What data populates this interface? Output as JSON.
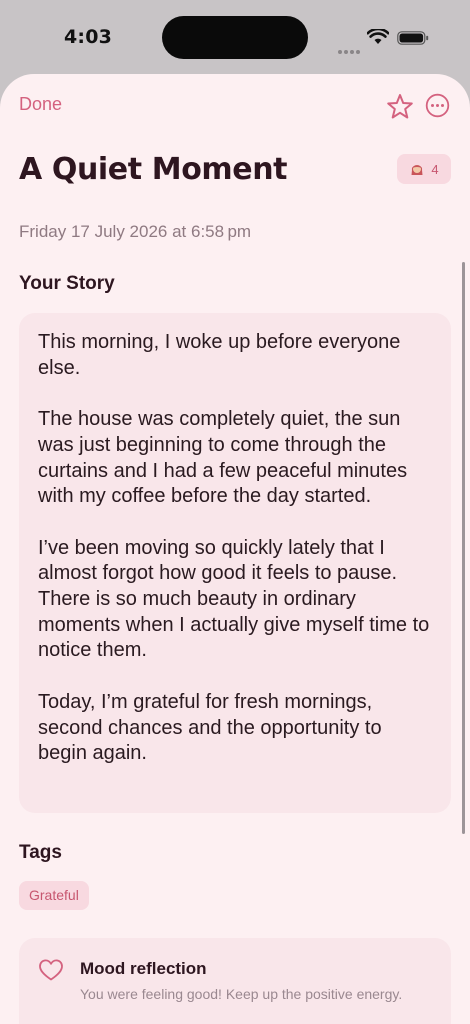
{
  "status_bar": {
    "time": "4:03"
  },
  "header": {
    "done_label": "Done"
  },
  "entry": {
    "title": "A Quiet Moment",
    "badge_count": "4",
    "date": "Friday 17 July 2026 at 6:58 pm"
  },
  "story": {
    "label": "Your Story",
    "text": "This morning, I woke up before everyone else.\n\nThe house was completely quiet, the sun was just beginning to come through the curtains and I had a few peaceful minutes with my coffee before the day started.\n\nI’ve been moving so quickly lately that I almost forgot how good it feels to pause. There is so much beauty in ordinary moments when I actually give myself time to notice them.\n\nToday, I’m grateful for fresh mornings, second chances and the opportunity to begin again."
  },
  "tags": {
    "label": "Tags",
    "items": [
      "Grateful"
    ]
  },
  "mood": {
    "title": "Mood reflection",
    "description": "You were feeling good! Keep up the positive energy."
  },
  "colors": {
    "accent": "#d4627f",
    "sheet_background": "#fdf0f2",
    "card_background": "#f9e6ea",
    "chip_background": "#f8d9e0",
    "title_text": "#2e1620"
  },
  "icons": {
    "favorite": "star-icon",
    "more": "ellipsis-circle-icon",
    "badge": "person-emoji-icon",
    "mood": "heart-icon"
  }
}
